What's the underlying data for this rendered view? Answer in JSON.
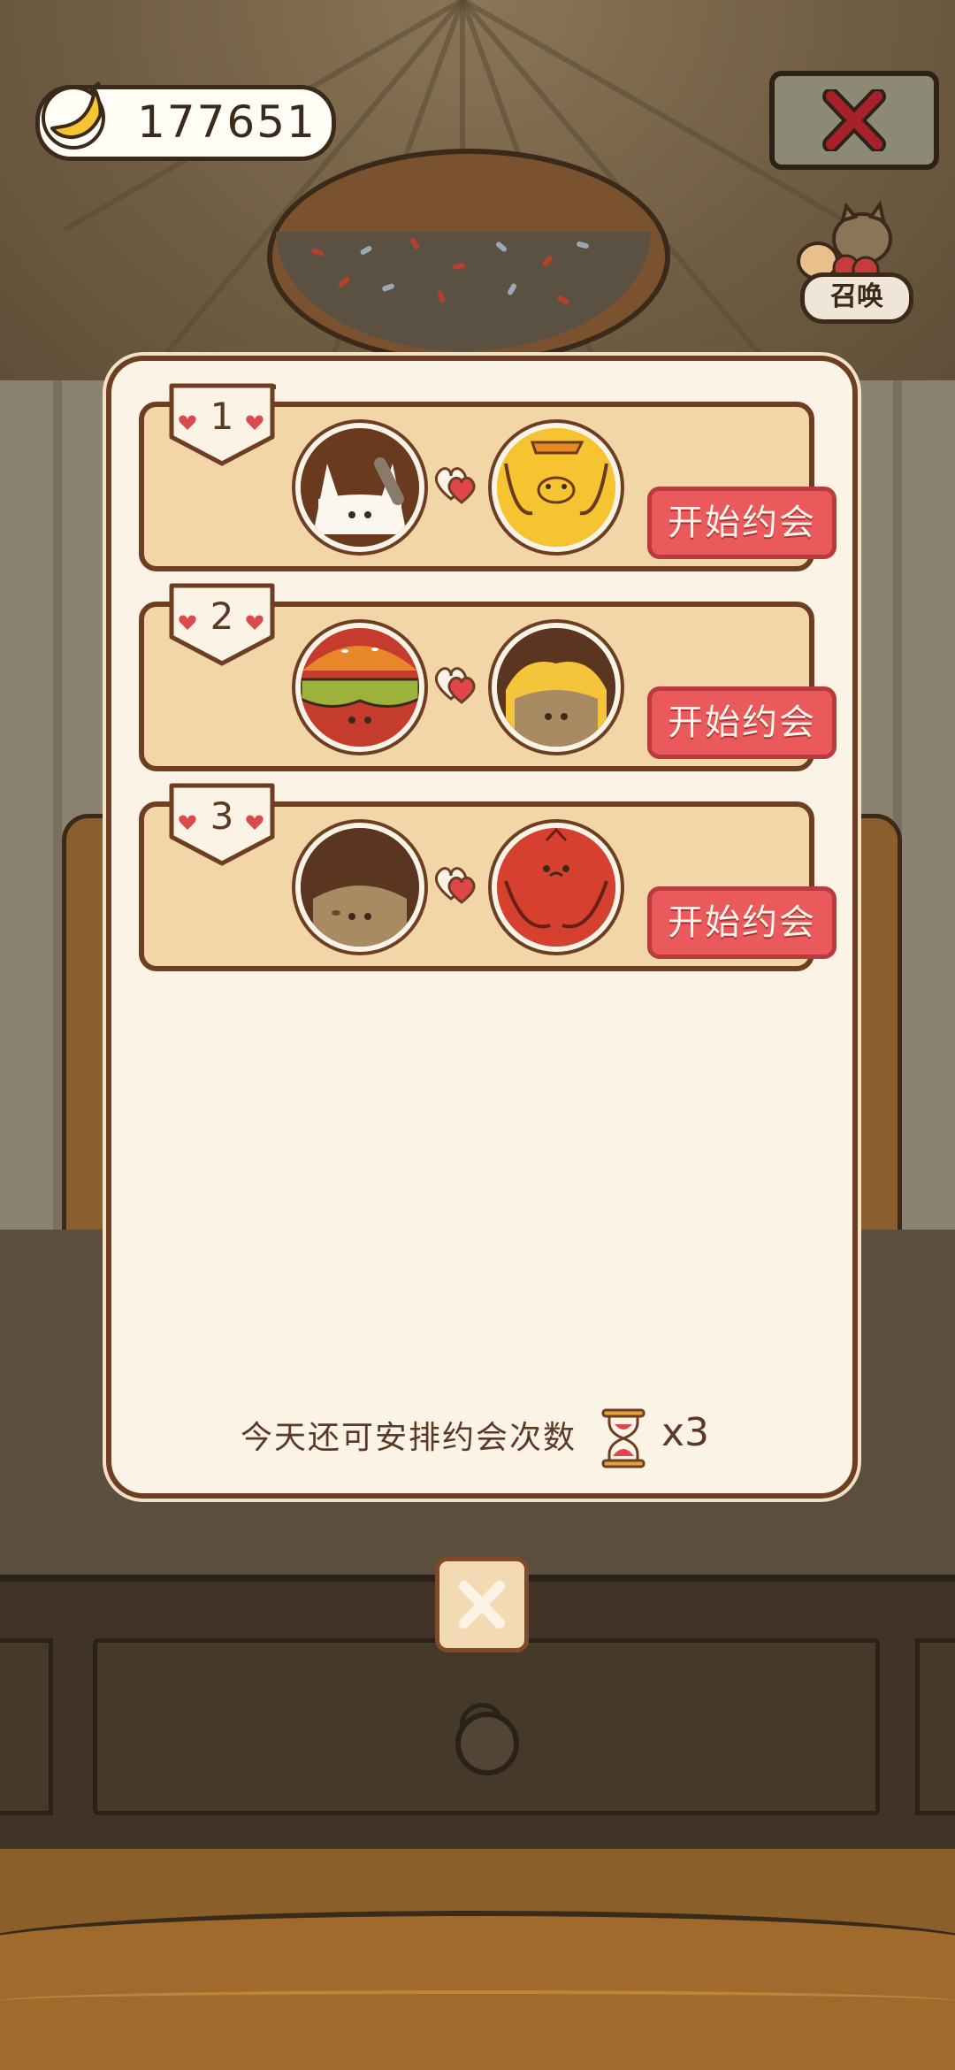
{
  "hud": {
    "banana_count": "177651",
    "summon_label": "召唤"
  },
  "dates": [
    {
      "rank": "1",
      "button_label": "开始约会",
      "left_character": "rabbit-avatar",
      "right_character": "yellow-dog-avatar"
    },
    {
      "rank": "2",
      "button_label": "开始约会",
      "left_character": "burger-avatar",
      "right_character": "yellow-blob-avatar"
    },
    {
      "rank": "3",
      "button_label": "开始约会",
      "left_character": "brown-blob-avatar",
      "right_character": "red-bird-avatar"
    }
  ],
  "footer": {
    "remaining_text": "今天还可安排约会次数",
    "remaining_count": "x3"
  },
  "colors": {
    "panel_bg": "#fbf3e6",
    "card_bg": "#f2d6a8",
    "button_red": "#ea5a5c",
    "border_brown": "#6e3e22"
  }
}
